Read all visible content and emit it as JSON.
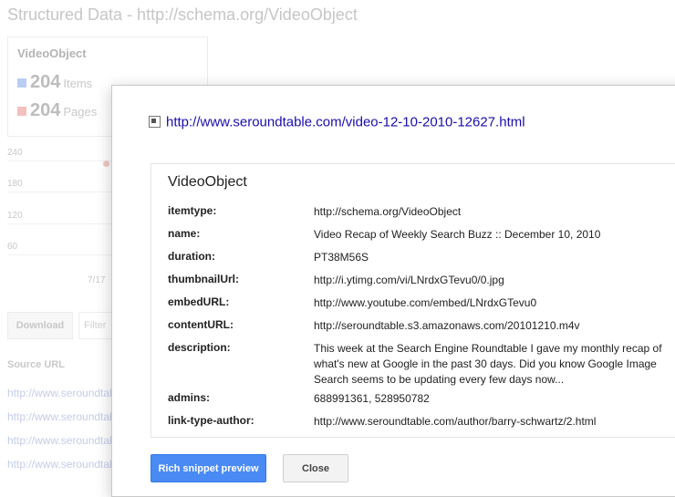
{
  "background": {
    "title": "Structured Data - http://schema.org/VideoObject",
    "summary": {
      "type_name": "VideoObject",
      "items_count": "204",
      "items_label": "Items",
      "pages_count": "204",
      "pages_label": "Pages",
      "items_color": "#b9cdf3",
      "pages_color": "#f3c0c0"
    },
    "chart": {
      "y_ticks": [
        "240",
        "180",
        "120",
        "60"
      ],
      "x_tick": "7/17"
    },
    "download_label": "Download",
    "filter_placeholder": "Filter",
    "source_url_header": "Source URL",
    "source_urls": [
      "http://www.seroundtable.com/",
      "http://www.seroundtable.com/",
      "http://www.seroundtable.com/",
      "http://www.seroundtable.com/"
    ]
  },
  "modal": {
    "url": "http://www.seroundtable.com/video-12-10-2010-12627.html",
    "section_title": "VideoObject",
    "properties": [
      {
        "key": "itemtype:",
        "value": "http://schema.org/VideoObject"
      },
      {
        "key": "name:",
        "value": "Video Recap of Weekly Search Buzz :: December 10, 2010"
      },
      {
        "key": "duration:",
        "value": "PT38M56S"
      },
      {
        "key": "thumbnailUrl:",
        "value": "http://i.ytimg.com/vi/LNrdxGTevu0/0.jpg"
      },
      {
        "key": "embedURL:",
        "value": "http://www.youtube.com/embed/LNrdxGTevu0"
      },
      {
        "key": "contentURL:",
        "value": "http://seroundtable.s3.amazonaws.com/20101210.m4v"
      },
      {
        "key": "description:",
        "value": "This week at the Search Engine Roundtable I gave my monthly recap of what's new at Google in the past 30 days. Did you know Google Image Search seems to be updating every few days now..."
      },
      {
        "key": "admins:",
        "value": "688991361, 528950782"
      },
      {
        "key": "link-type-author:",
        "value": "http://www.seroundtable.com/author/barry-schwartz/2.html"
      }
    ],
    "primary_button": "Rich snippet preview",
    "close_button": "Close"
  },
  "colors": {
    "primary_blue": "#4a8af4",
    "link_blue": "#1a0dab"
  }
}
